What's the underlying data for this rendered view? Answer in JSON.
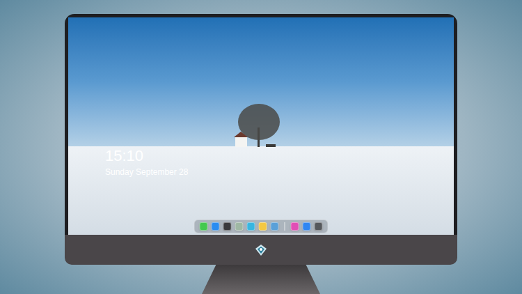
{
  "lock_screen": {
    "time": "15:10",
    "date": "Sunday September 28"
  },
  "dock": {
    "items": [
      {
        "kind": "app",
        "color": "#44c94f"
      },
      {
        "kind": "app",
        "color": "#2a8cf0"
      },
      {
        "kind": "app",
        "color": "#3a3a3c"
      },
      {
        "kind": "app",
        "color": "#9fb8a4"
      },
      {
        "kind": "app",
        "color": "#38b6e0"
      },
      {
        "kind": "app",
        "color": "#f5c842"
      },
      {
        "kind": "app",
        "color": "#5aa0d8"
      },
      {
        "kind": "separator",
        "color": "#ffffff"
      },
      {
        "kind": "app",
        "color": "#e14fb5"
      },
      {
        "kind": "app",
        "color": "#2f86f2"
      },
      {
        "kind": "app",
        "color": "#55585c"
      }
    ]
  }
}
